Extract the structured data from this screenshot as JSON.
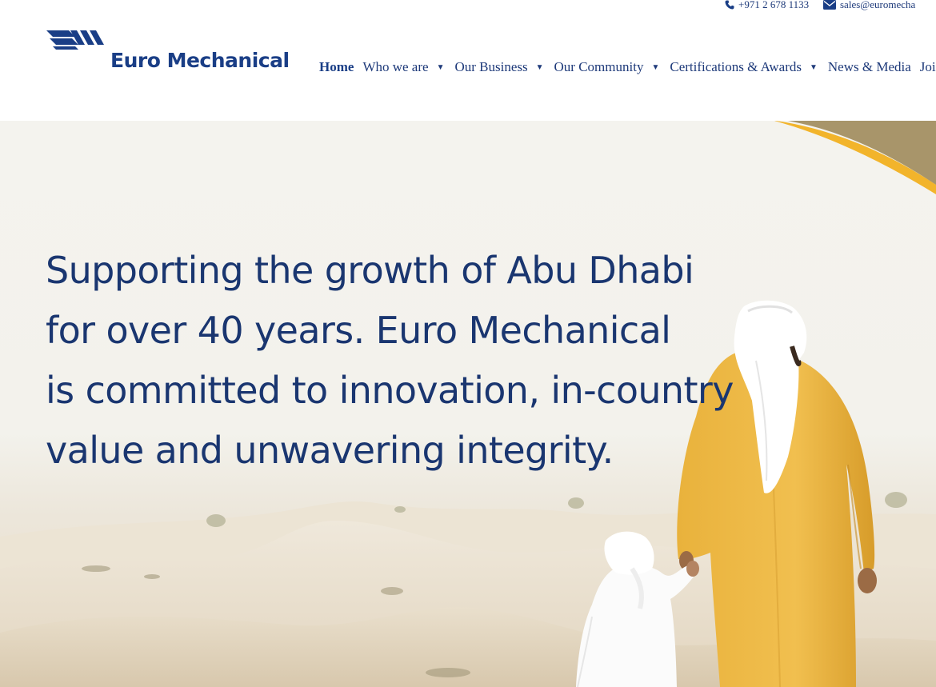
{
  "contact": {
    "phone": "+971 2 678 1133",
    "email": "sales@euromecha",
    "phone_icon": "phone-icon",
    "email_icon": "envelope-icon"
  },
  "brand": {
    "name": "Euro Mechanical",
    "primary_color": "#1a3e86",
    "accent_color": "#f2b42b"
  },
  "nav": {
    "items": [
      {
        "label": "Home",
        "active": true,
        "dropdown": false
      },
      {
        "label": "Who we are",
        "dropdown": true
      },
      {
        "label": "Our Business",
        "dropdown": true
      },
      {
        "label": "Our Community",
        "dropdown": true
      },
      {
        "label": "Certifications & Awards",
        "dropdown": true
      },
      {
        "label": "News & Media",
        "dropdown": false
      },
      {
        "label": "Join U",
        "dropdown": false
      }
    ]
  },
  "hero": {
    "lines": [
      "Supporting the growth of Abu Dhabi",
      "for over 40 years. Euro Mechanical",
      "is committed to innovation, in-country",
      "value and unwavering integrity."
    ]
  }
}
